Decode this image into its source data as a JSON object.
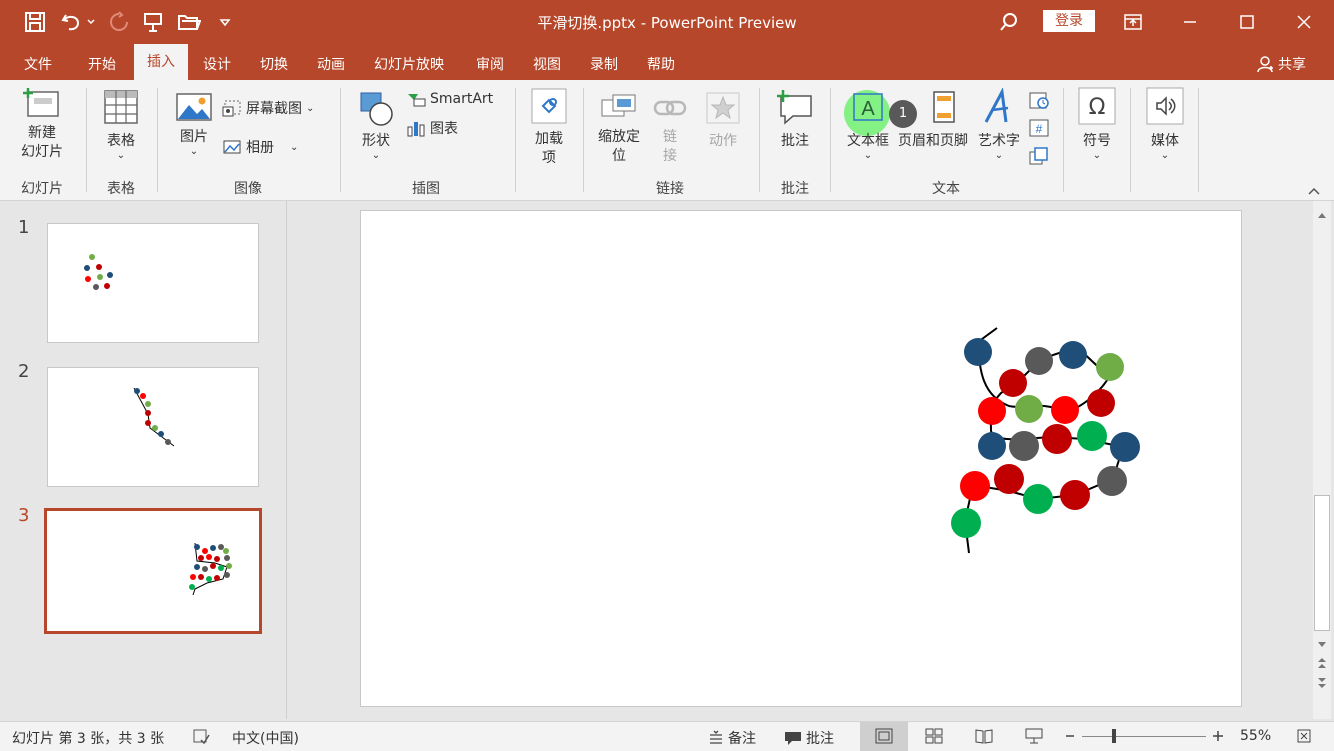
{
  "window": {
    "title": "平滑切换.pptx  -  PowerPoint Preview",
    "login_label": "登录"
  },
  "menu": {
    "items": [
      "文件",
      "开始",
      "插入",
      "设计",
      "切换",
      "动画",
      "幻灯片放映",
      "审阅",
      "视图",
      "录制",
      "帮助"
    ],
    "active": "插入",
    "share_label": "共享"
  },
  "ribbon": {
    "new_slide": "新建\n幻灯片",
    "table": "表格",
    "picture": "图片",
    "screenshot": "屏幕截图",
    "album": "相册",
    "shapes": "形状",
    "smartart": "SmartArt",
    "chart": "图表",
    "addins": "加载\n项",
    "zoom": "缩放定\n位",
    "link": "链\n接",
    "action": "动作",
    "comment": "批注",
    "textbox": "文本框",
    "header_footer": "页眉和页脚",
    "wordart": "艺术字",
    "symbols": "符号",
    "media": "媒体",
    "badge": "1",
    "groups": {
      "slides": "幻灯片",
      "tables": "表格",
      "images": "图像",
      "illustrations": "插图",
      "links": "链接",
      "comments": "批注",
      "text": "文本"
    }
  },
  "slides": [
    {
      "number": "1"
    },
    {
      "number": "2"
    },
    {
      "number": "3",
      "selected": true
    }
  ],
  "status": {
    "slide_info": "幻灯片 第 3 张，共 3 张",
    "language": "中文(中国)",
    "notes": "备注",
    "comments": "批注",
    "zoom": "55%"
  },
  "colors": {
    "accent": "#b7472a",
    "dark_blue": "#1f4e79",
    "red": "#ff0000",
    "dark_red": "#c00000",
    "gray": "#595959",
    "light_green": "#70ad47",
    "green": "#00b050"
  }
}
